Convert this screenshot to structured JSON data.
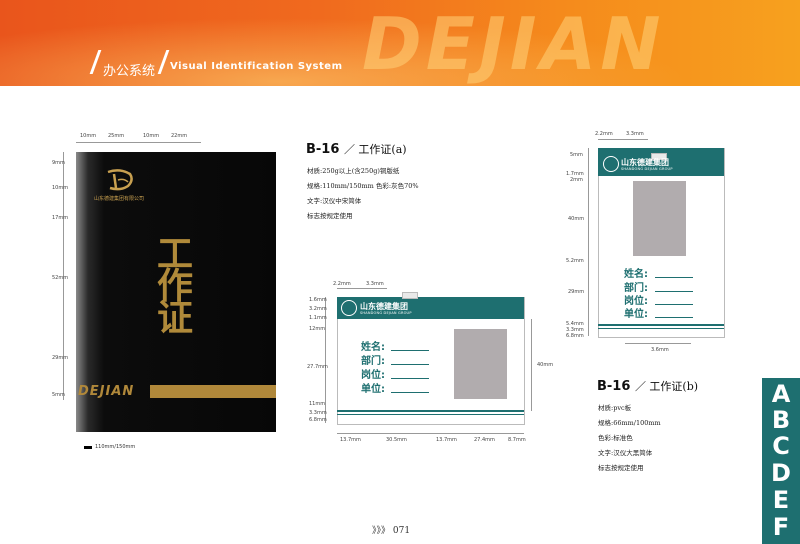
{
  "header": {
    "section_cn": "办公系统",
    "section_en": "Visual Identification System",
    "brand_word": "DEJIAN"
  },
  "card_black": {
    "dims_top": [
      "10mm",
      "25mm",
      "10mm",
      "22mm"
    ],
    "dims_left": [
      "9mm",
      "10mm",
      "17mm",
      "52mm",
      "29mm",
      "5mm"
    ],
    "logo_text": "山东德建集团有限公司",
    "title_chars": [
      "工",
      "作",
      "证"
    ],
    "bar_word": "DEJIAN",
    "swatch_label": "110mm/150mm"
  },
  "spec_a": {
    "code": "B-16",
    "title": "／ 工作证(a)",
    "lines": [
      "材质:250g以上(含250g)铜版纸",
      "规格:110mm/150mm   色彩:灰色70%",
      "文字:汉仪中宋简体",
      "标志按规定使用"
    ]
  },
  "spec_b": {
    "code": "B-16",
    "title": "／ 工作证(b)",
    "lines": [
      "材质:pvc板",
      "规格:66mm/100mm",
      "色彩:标准色",
      "文字:汉仪大黑简体",
      "标志按规定使用"
    ]
  },
  "card_h": {
    "logo_cn": "山东德建集团",
    "logo_en": "SHANDONG DEJIAN GROUP",
    "fields": [
      "姓名:",
      "部门:",
      "岗位:",
      "单位:"
    ],
    "dims_top": [
      "2.2mm",
      "3.3mm"
    ],
    "dims_left": [
      "1.6mm",
      "3.2mm",
      "1.1mm",
      "12mm",
      "27.7mm",
      "11mm",
      "3.3mm",
      "6.8mm"
    ],
    "dims_bottom": [
      "13.7mm",
      "30.5mm",
      "13.7mm",
      "27.4mm",
      "8.7mm"
    ],
    "dim_right": "40mm"
  },
  "card_v": {
    "logo_cn": "山东德建集团",
    "logo_en": "SHANDONG DEJIAN GROUP",
    "fields": [
      "姓名:",
      "部门:",
      "岗位:",
      "单位:"
    ],
    "dims_top": [
      "2.2mm",
      "3.3mm"
    ],
    "dims_left": [
      "5mm",
      "1.7mm",
      "2mm",
      "40mm",
      "5.2mm",
      "29mm",
      "5.4mm",
      "3.3mm",
      "6.8mm"
    ],
    "dim_bottom": "3.6mm"
  },
  "side_letters": [
    "A",
    "B",
    "C",
    "D",
    "E",
    "F"
  ],
  "footer": {
    "page": "》》》 071"
  },
  "colors": {
    "banner": "#e9551c",
    "teal": "#1e6f70",
    "gold": "#b0883a"
  }
}
